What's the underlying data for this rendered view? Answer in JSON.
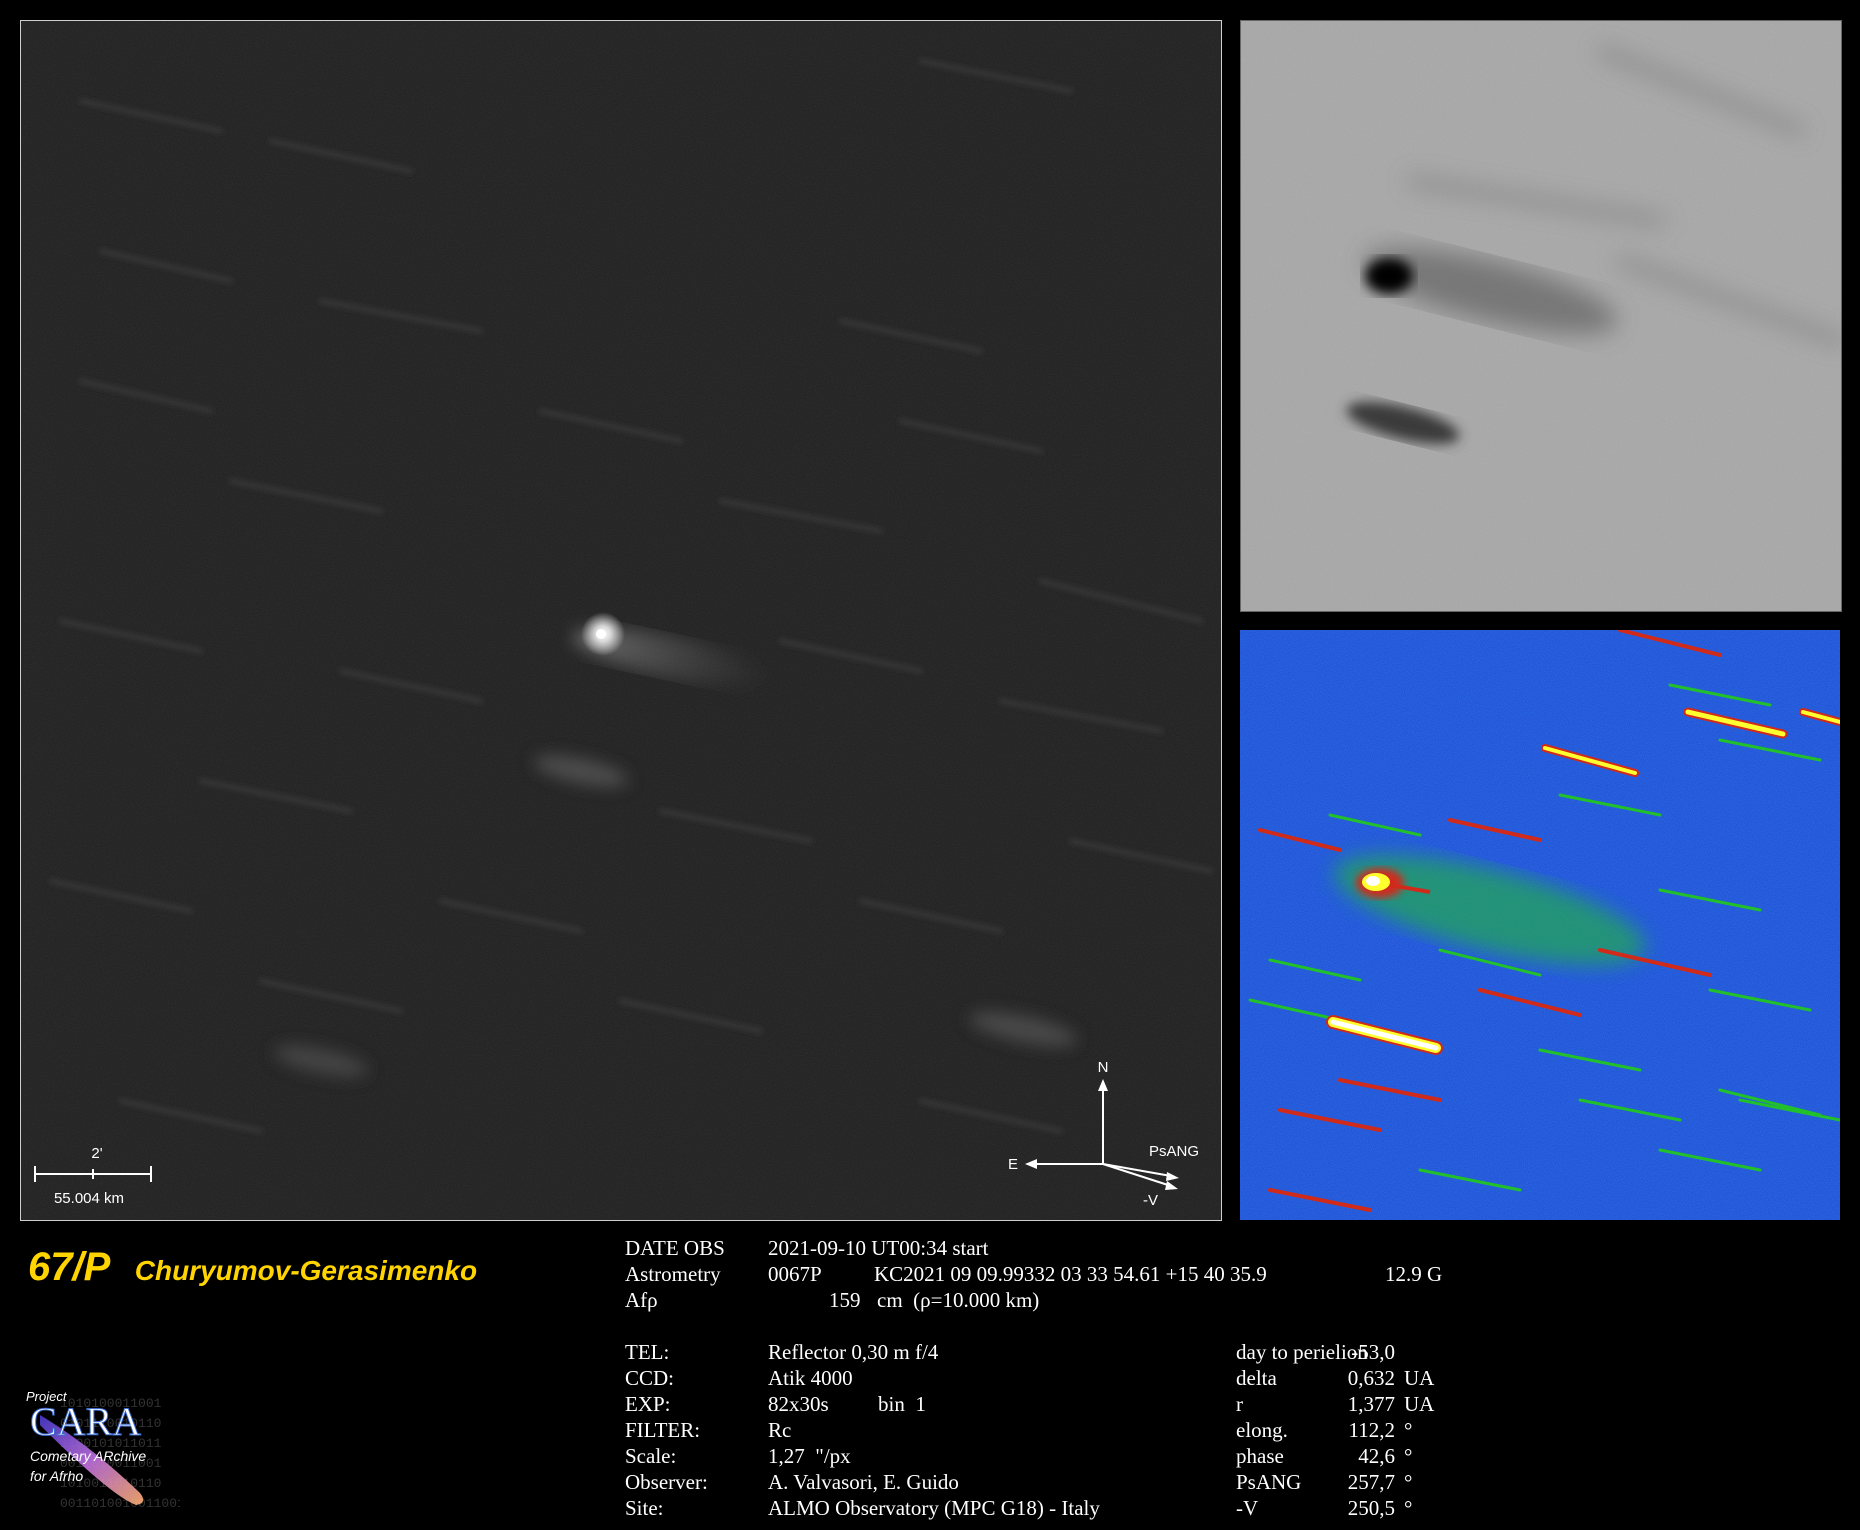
{
  "object": {
    "number": "67/P",
    "name": "Churyumov-Gerasimenko"
  },
  "scale_bar": {
    "angle": "2'",
    "distance": "55.004 km"
  },
  "compass": {
    "north": "N",
    "east": "E",
    "psang": "PsANG",
    "minus_v": "-V"
  },
  "astro": {
    "date_label": "DATE OBS",
    "date_value": "2021-09-10 UT00:34 start",
    "astrometry_label": "Astrometry",
    "astrometry_id": "0067P",
    "astrometry_value": "KC2021 09 09.99332 03 33 54.61 +15 40 35.9",
    "astrometry_mag": "12.9 G",
    "afrho_label": "Afρ",
    "afrho_value": "159",
    "afrho_unit": "cm  (ρ=10.000 km)"
  },
  "instrument": {
    "tel_label": "TEL:",
    "tel_value": "Reflector 0,30 m f/4",
    "ccd_label": "CCD:",
    "ccd_value": "Atik 4000",
    "exp_label": "EXP:",
    "exp_value": "82x30s",
    "exp_bin": "bin  1",
    "filter_label": "FILTER:",
    "filter_value": "Rc",
    "scale_label": "Scale:",
    "scale_value": "1,27  \"/px",
    "observer_label": "Observer:",
    "observer_value": "A. Valvasori, E. Guido",
    "site_label": "Site:",
    "site_value": "ALMO Observatory (MPC G18) - Italy"
  },
  "ephemeris": [
    {
      "label": "day to perielion",
      "value": "-53,0",
      "unit": ""
    },
    {
      "label": "delta",
      "value": "0,632",
      "unit": "UA"
    },
    {
      "label": "r",
      "value": "1,377",
      "unit": "UA"
    },
    {
      "label": "elong.",
      "value": "112,2",
      "unit": "°"
    },
    {
      "label": "phase",
      "value": "42,6",
      "unit": "°"
    },
    {
      "label": "PsANG",
      "value": "257,7",
      "unit": "°"
    },
    {
      "label": "-V",
      "value": "250,5",
      "unit": "°"
    }
  ],
  "logo": {
    "project": "Project",
    "cara": "CARA",
    "line1": "Cometary ARchive",
    "line2": "for Afrho",
    "binary": [
      "1010100011001",
      "0101110010110",
      "1100101011011",
      "0011010011001",
      "1010011010110",
      "0011010010011001"
    ]
  },
  "colors": {
    "title": "#ffd400",
    "map_bg": "#1b3fd0",
    "map_green": "#22c02a",
    "map_red": "#d02a1a",
    "map_yellow": "#ffff30"
  }
}
